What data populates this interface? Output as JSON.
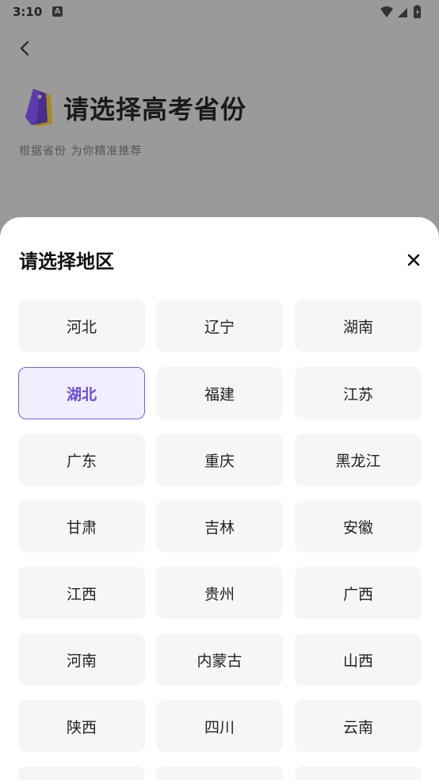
{
  "status_bar": {
    "time": "3:10",
    "notification_glyph": "A"
  },
  "background_page": {
    "title": "请选择高考省份",
    "subtitle": "根据省份 为你精准推荐"
  },
  "sheet": {
    "title": "请选择地区",
    "regions": [
      {
        "label": "河北",
        "selected": false
      },
      {
        "label": "辽宁",
        "selected": false
      },
      {
        "label": "湖南",
        "selected": false
      },
      {
        "label": "湖北",
        "selected": true
      },
      {
        "label": "福建",
        "selected": false
      },
      {
        "label": "江苏",
        "selected": false
      },
      {
        "label": "广东",
        "selected": false
      },
      {
        "label": "重庆",
        "selected": false
      },
      {
        "label": "黑龙江",
        "selected": false
      },
      {
        "label": "甘肃",
        "selected": false
      },
      {
        "label": "吉林",
        "selected": false
      },
      {
        "label": "安徽",
        "selected": false
      },
      {
        "label": "江西",
        "selected": false
      },
      {
        "label": "贵州",
        "selected": false
      },
      {
        "label": "广西",
        "selected": false
      },
      {
        "label": "河南",
        "selected": false
      },
      {
        "label": "内蒙古",
        "selected": false
      },
      {
        "label": "山西",
        "selected": false
      },
      {
        "label": "陕西",
        "selected": false
      },
      {
        "label": "四川",
        "selected": false
      },
      {
        "label": "云南",
        "selected": false
      },
      {
        "label": "",
        "selected": false
      },
      {
        "label": "",
        "selected": false
      },
      {
        "label": "",
        "selected": false
      }
    ]
  },
  "colors": {
    "accent": "#7a5ce6",
    "selected_bg": "#f1eefe",
    "tile_bg": "#f6f6f6",
    "overlay": "#9a9a9a"
  }
}
